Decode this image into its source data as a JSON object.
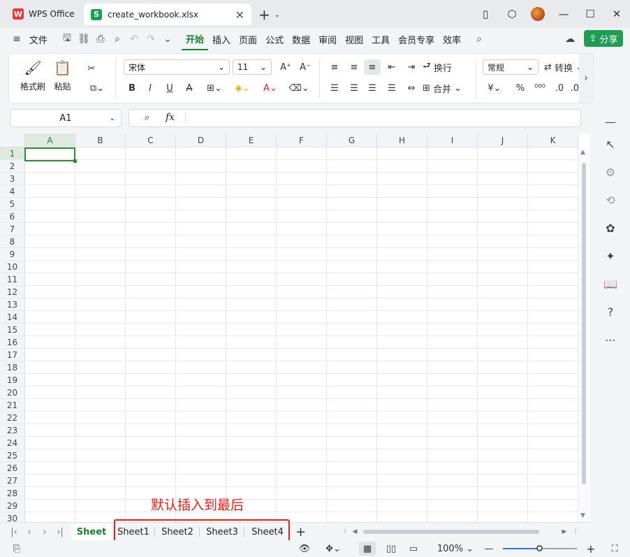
{
  "app": {
    "home_tab": "WPS Office",
    "doc_tab": "create_workbook.xlsx"
  },
  "menu": {
    "file": "文件",
    "tabs": [
      "开始",
      "插入",
      "页面",
      "公式",
      "数据",
      "审阅",
      "视图",
      "工具",
      "会员专享",
      "效率"
    ],
    "active_tab": "开始",
    "share": "分享"
  },
  "ribbon": {
    "format_painter": "格式刷",
    "paste": "粘贴",
    "font_name": "宋体",
    "font_size": "11",
    "wrap_text": "换行",
    "merge": "合并",
    "number_format": "常规",
    "convert": "转换"
  },
  "formula_bar": {
    "cell_ref": "A1",
    "fx_label": "fx",
    "value": ""
  },
  "grid": {
    "columns": [
      "A",
      "B",
      "C",
      "D",
      "E",
      "F",
      "G",
      "H",
      "I",
      "J",
      "K"
    ],
    "rows": [
      "1",
      "2",
      "3",
      "4",
      "5",
      "6",
      "7",
      "8",
      "9",
      "10",
      "11",
      "12",
      "13",
      "14",
      "15",
      "16",
      "17",
      "18",
      "19",
      "20",
      "21",
      "22",
      "23",
      "24",
      "25",
      "26",
      "27",
      "28",
      "29",
      "30"
    ],
    "active_cell": "A1"
  },
  "sheets": {
    "tabs": [
      "Sheet",
      "Sheet1",
      "Sheet2",
      "Sheet3",
      "Sheet4"
    ],
    "active": "Sheet",
    "annotation": "默认插入到最后"
  },
  "status": {
    "zoom": "100%",
    "zoom_level_percent": 50
  },
  "colors": {
    "accent": "#1e7e34",
    "share_bg": "#1f9d55",
    "annotation": "#e0201c",
    "wps_logo": "#e53935"
  }
}
